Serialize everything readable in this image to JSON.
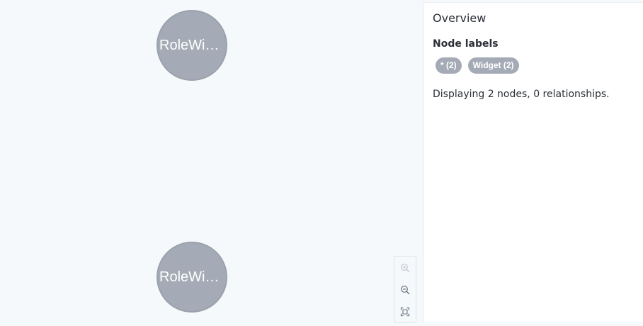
{
  "graph": {
    "nodes": [
      {
        "caption": "RoleWid…"
      },
      {
        "caption": "RoleWid…"
      }
    ]
  },
  "zoom_controls": {
    "icons": [
      "zoom-in-icon",
      "zoom-out-icon",
      "fit-to-screen-icon"
    ]
  },
  "overview": {
    "title": "Overview",
    "node_labels_heading": "Node labels",
    "labels": [
      {
        "text": "* (2)"
      },
      {
        "text": "Widget (2)"
      }
    ],
    "summary": "Displaying 2 nodes, 0 relationships."
  },
  "colors": {
    "canvas_background": "#f5f9fc",
    "node_fill": "#a5abb6",
    "node_text": "#ffffff",
    "tag_fill": "#a5abb6",
    "panel_background": "#ffffff",
    "text": "#2b2f36"
  }
}
